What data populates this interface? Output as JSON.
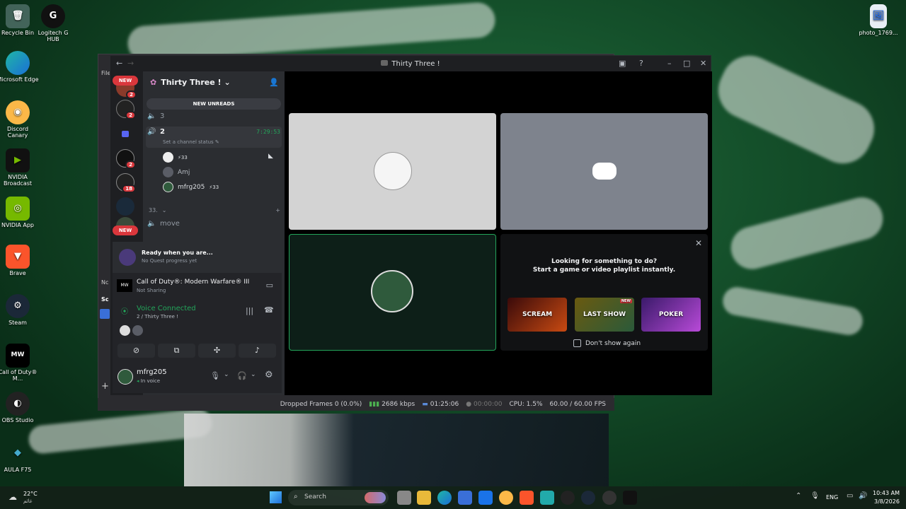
{
  "desktop": {
    "icons": [
      {
        "label": "Recycle Bin",
        "icon": "recycle-bin-icon"
      },
      {
        "label": "Logitech G HUB",
        "icon": "logitech-icon"
      },
      {
        "label": "Microsoft Edge",
        "icon": "edge-icon"
      },
      {
        "label": "Discord Canary",
        "icon": "discord-icon"
      },
      {
        "label": "NVIDIA Broadcast",
        "icon": "nvidia-icon"
      },
      {
        "label": "NVIDIA App",
        "icon": "nvidia-icon"
      },
      {
        "label": "Brave",
        "icon": "brave-icon"
      },
      {
        "label": "Steam",
        "icon": "steam-icon"
      },
      {
        "label": "Call of Duty® M...",
        "icon": "cod-icon"
      },
      {
        "label": "OBS Studio",
        "icon": "obs-icon"
      },
      {
        "label": "AULA F75",
        "icon": "aula-icon"
      },
      {
        "label": "photo_1769...",
        "icon": "image-file-icon"
      }
    ]
  },
  "obs": {
    "status": {
      "dropped": "Dropped Frames 0 (0.0%)",
      "bitrate": "2686 kbps",
      "stream_time": "01:25:06",
      "rec_time": "00:00:00",
      "cpu": "CPU: 1.5%",
      "fps": "60.00 / 60.00 FPS"
    },
    "menu_label": "File"
  },
  "window": {
    "title": "Thirty Three !"
  },
  "guilds": {
    "new_top": "NEW",
    "new_bottom": "NEW",
    "badges": [
      "2",
      "2",
      "2",
      "18"
    ]
  },
  "channels": {
    "server_name": "Thirty Three !",
    "new_unreads": "NEW UNREADS",
    "voice_3": "3",
    "voice_2": "2",
    "voice_2_timer": "7:29:53",
    "channel_status": "Set a channel status",
    "users": [
      {
        "name": "",
        "badge": "33"
      },
      {
        "name": "Amj",
        "badge": ""
      },
      {
        "name": "mfrg205",
        "badge": "33"
      }
    ],
    "category": "33.",
    "move": "move"
  },
  "quest": {
    "title": "Ready when you are...",
    "subtitle": "No Quest progress yet"
  },
  "activity": {
    "game": "Call of Duty®: Modern Warfare® III",
    "status": "Not Sharing"
  },
  "voice": {
    "connected": "Voice Connected",
    "location": "2 / Thirty Three !"
  },
  "user": {
    "name": "mfrg205",
    "status": "In voice"
  },
  "stage": {
    "prompt_line1": "Looking for something to do?",
    "prompt_line2": "Start a game or video playlist instantly.",
    "games": [
      "SCREAM",
      "LAST SHOW",
      "POKER"
    ],
    "game_new_badge": "NEW",
    "dont_show": "Don't show again"
  },
  "taskbar": {
    "weather_temp": "22°C",
    "weather_label": "غائم",
    "search": "Search",
    "lang": "ENG",
    "time": "10:43 AM",
    "date": "3/8/2026"
  },
  "colors": {
    "discord_green": "#23a55a",
    "discord_red": "#da373c",
    "blurple": "#5865f2"
  }
}
